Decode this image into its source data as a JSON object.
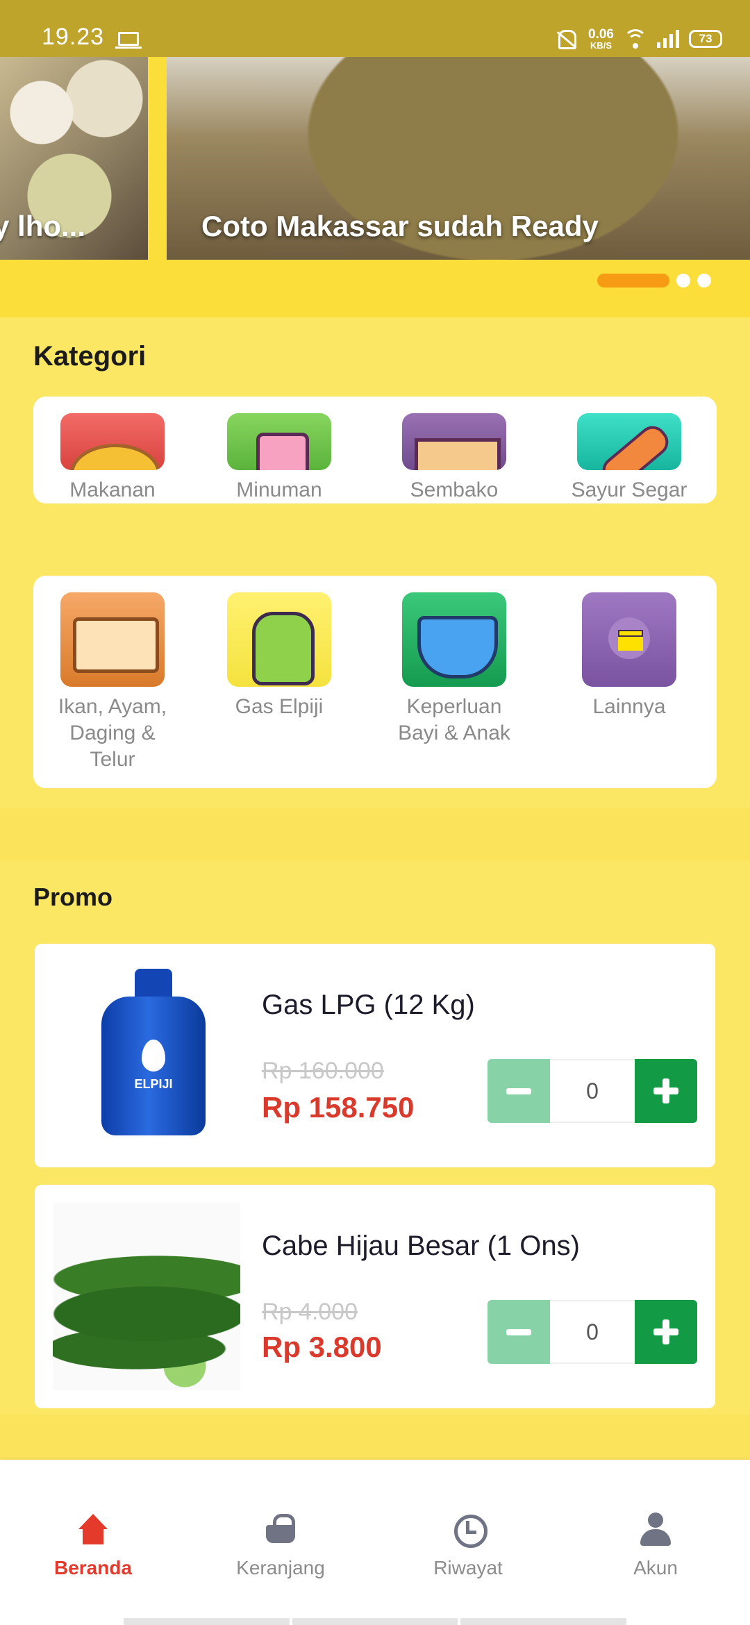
{
  "status_bar": {
    "time": "19.23",
    "net_speed_value": "0.06",
    "net_speed_unit": "KB/S",
    "battery": "73",
    "color": "#bfa42c"
  },
  "banner": {
    "prev_caption": "y lho...",
    "main_caption": "Coto Makassar sudah Ready",
    "slide_count": 3,
    "active_slide": 1,
    "active_dot_color": "#f79b14"
  },
  "kategori": {
    "title": "Kategori",
    "row1": [
      {
        "label": "Makanan",
        "icon": "fried-chicken-icon"
      },
      {
        "label": "Minuman",
        "icon": "drink-cup-icon"
      },
      {
        "label": "Sembako",
        "icon": "grocery-box-icon"
      },
      {
        "label": "Sayur Segar",
        "icon": "carrot-icon"
      }
    ],
    "row2": [
      {
        "label": "Ikan, Ayam, Daging & Telur",
        "icon": "tofu-icon"
      },
      {
        "label": "Gas Elpiji",
        "icon": "gas-cylinder-icon"
      },
      {
        "label": "Keperluan Bayi & Anak",
        "icon": "diaper-icon"
      },
      {
        "label": "Lainnya",
        "icon": "menu-icon"
      }
    ]
  },
  "promo": {
    "title": "Promo",
    "products": [
      {
        "name": "Gas LPG (12 Kg)",
        "price_old": "Rp 160.000",
        "price_new": "Rp 158.750",
        "qty": "0",
        "image_brand": "ELPIJI"
      },
      {
        "name": "Cabe Hijau Besar (1 Ons)",
        "price_old": "Rp 4.000",
        "price_new": "Rp 3.800",
        "qty": "0"
      }
    ]
  },
  "bottom_nav": {
    "items": [
      {
        "label": "Beranda",
        "icon": "home-icon",
        "active": true
      },
      {
        "label": "Keranjang",
        "icon": "basket-icon",
        "active": false
      },
      {
        "label": "Riwayat",
        "icon": "history-icon",
        "active": false
      },
      {
        "label": "Akun",
        "icon": "user-icon",
        "active": false
      }
    ],
    "active_color": "#e33a2c"
  }
}
